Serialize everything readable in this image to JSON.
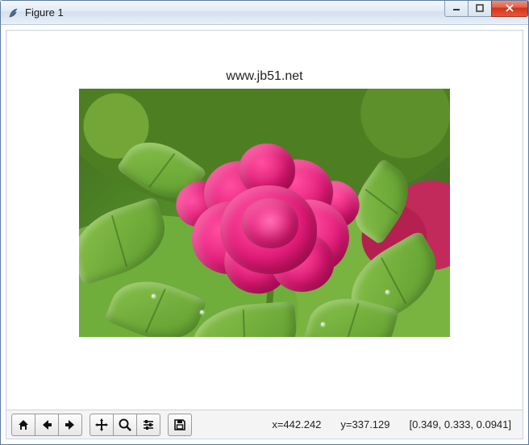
{
  "window": {
    "title": "Figure 1"
  },
  "plot": {
    "title": "www.jb51.net"
  },
  "toolbar": {
    "icons": {
      "home": "home-icon",
      "back": "arrow-left-icon",
      "forward": "arrow-right-icon",
      "pan": "move-icon",
      "zoom": "zoom-icon",
      "configure": "sliders-icon",
      "save": "save-icon"
    }
  },
  "status": {
    "x_label": "x=",
    "x_value": "442.242",
    "y_label": "y=",
    "y_value": "337.129",
    "rgb": "[0.349, 0.333, 0.0941]"
  }
}
